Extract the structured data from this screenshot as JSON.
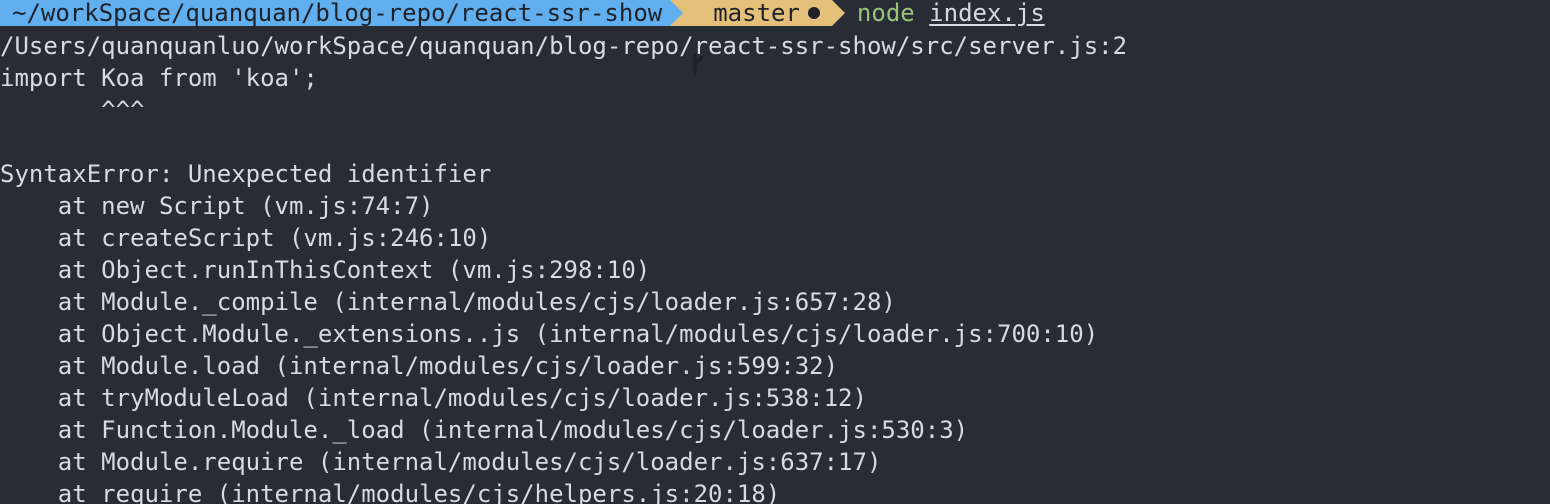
{
  "prompt": {
    "directory": "~/workSpace/quanquan/blog-repo/react-ssr-show",
    "branch": "master",
    "command": "node",
    "argument": "index.js"
  },
  "output": {
    "file_line": "/Users/quanquanluo/workSpace/quanquan/blog-repo/react-ssr-show/src/server.js:2",
    "source_line": "import Koa from 'koa';",
    "caret_line": "       ^^^",
    "blank_line": "",
    "error_line": "SyntaxError: Unexpected identifier",
    "stack": [
      "    at new Script (vm.js:74:7)",
      "    at createScript (vm.js:246:10)",
      "    at Object.runInThisContext (vm.js:298:10)",
      "    at Module._compile (internal/modules/cjs/loader.js:657:28)",
      "    at Object.Module._extensions..js (internal/modules/cjs/loader.js:700:10)",
      "    at Module.load (internal/modules/cjs/loader.js:599:32)",
      "    at tryModuleLoad (internal/modules/cjs/loader.js:538:12)",
      "    at Function.Module._load (internal/modules/cjs/loader.js:530:3)",
      "    at Module.require (internal/modules/cjs/loader.js:637:17)",
      "    at require (internal/modules/cjs/helpers.js:20:18)"
    ]
  },
  "colors": {
    "background": "#282c34",
    "text": "#d7dae0",
    "dir_segment": "#61afef",
    "git_segment": "#e5c07b",
    "command": "#98c379"
  },
  "icons": {
    "branch": "git-branch-icon",
    "dirty": "dirty-status-dot-icon"
  }
}
